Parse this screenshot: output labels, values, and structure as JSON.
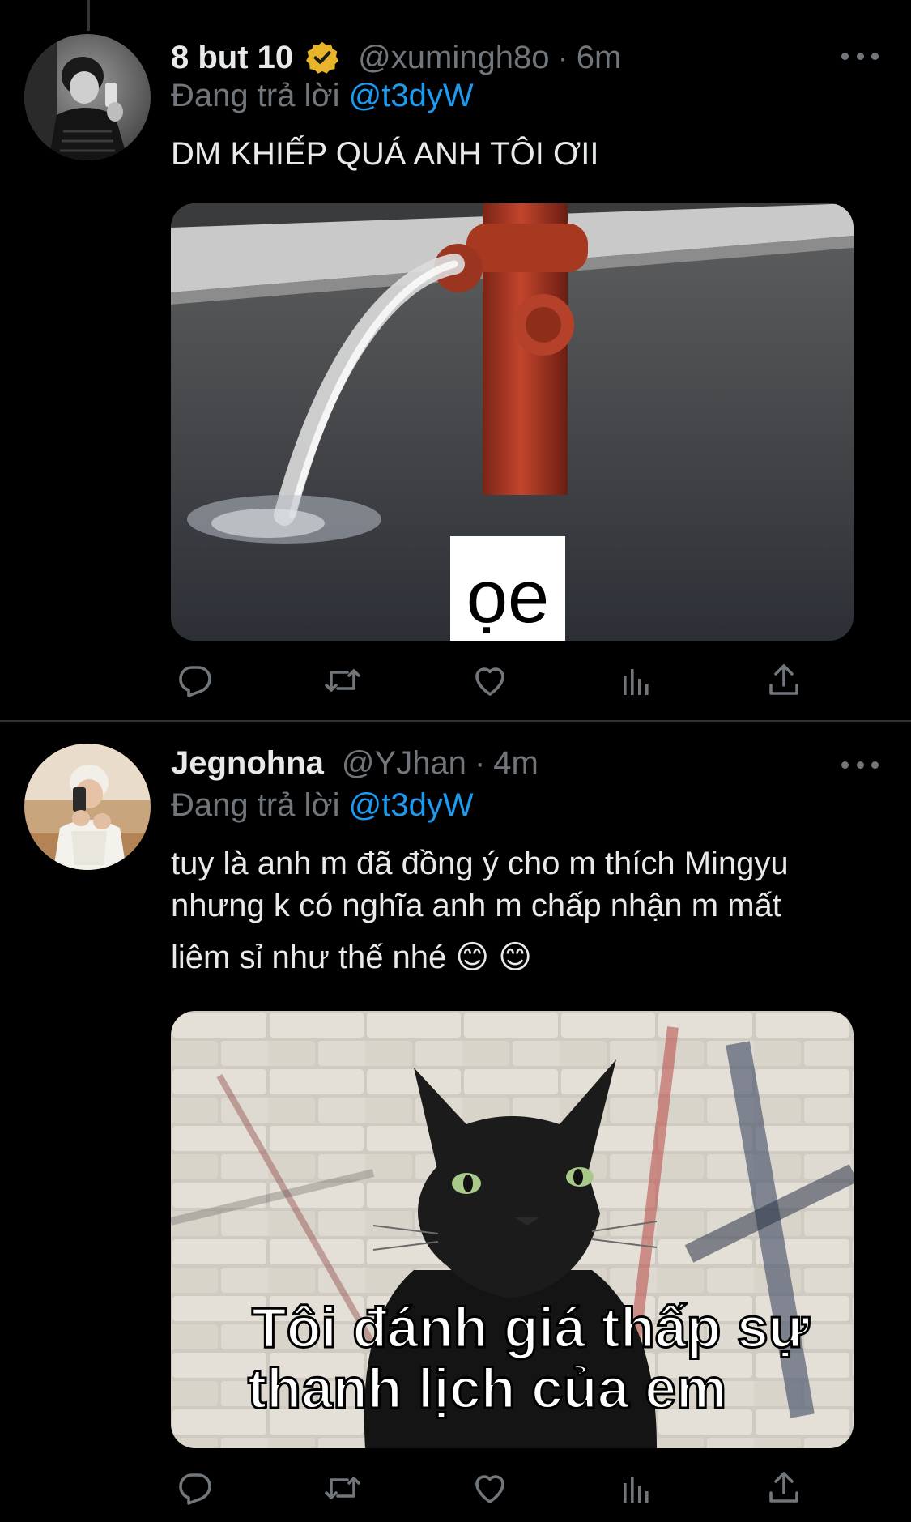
{
  "theme": {
    "background": "#000000",
    "text": "#e7e9ea",
    "muted": "#71767b",
    "link": "#1d9bf0",
    "verified_badge": "#e8b52a",
    "divider": "#2f3336"
  },
  "tweets": [
    {
      "display_name": "8 but 10",
      "verified": true,
      "handle": "@xumingh8o",
      "separator": "·",
      "time": "6m",
      "reply_prefix": "Đang trả lời",
      "reply_to": "@t3dyW",
      "text": "DM KHIẾP QUÁ ANH TÔI ƠII",
      "media": {
        "description_icon": "fire-hydrant-meme-image",
        "caption": "ọe"
      },
      "actions": [
        "reply-icon",
        "retweet-icon",
        "like-icon",
        "analytics-icon",
        "share-icon"
      ]
    },
    {
      "display_name": "Jegnohna",
      "verified": false,
      "handle": "@YJhan",
      "separator": "·",
      "time": "4m",
      "reply_prefix": "Đang trả lời",
      "reply_to": "@t3dyW",
      "text_lines": [
        "tuy là anh m đã đồng ý cho m thích Mingyu",
        "nhưng k có nghĩa anh m chấp nhận m mất",
        "liêm sỉ như thế nhé 😊 😊"
      ],
      "media": {
        "description_icon": "black-cat-meme-image",
        "caption_line1": "Tôi đánh giá thấp sự",
        "caption_line2": "thanh lịch của em"
      },
      "actions": [
        "reply-icon",
        "retweet-icon",
        "like-icon",
        "analytics-icon",
        "share-icon"
      ]
    }
  ]
}
